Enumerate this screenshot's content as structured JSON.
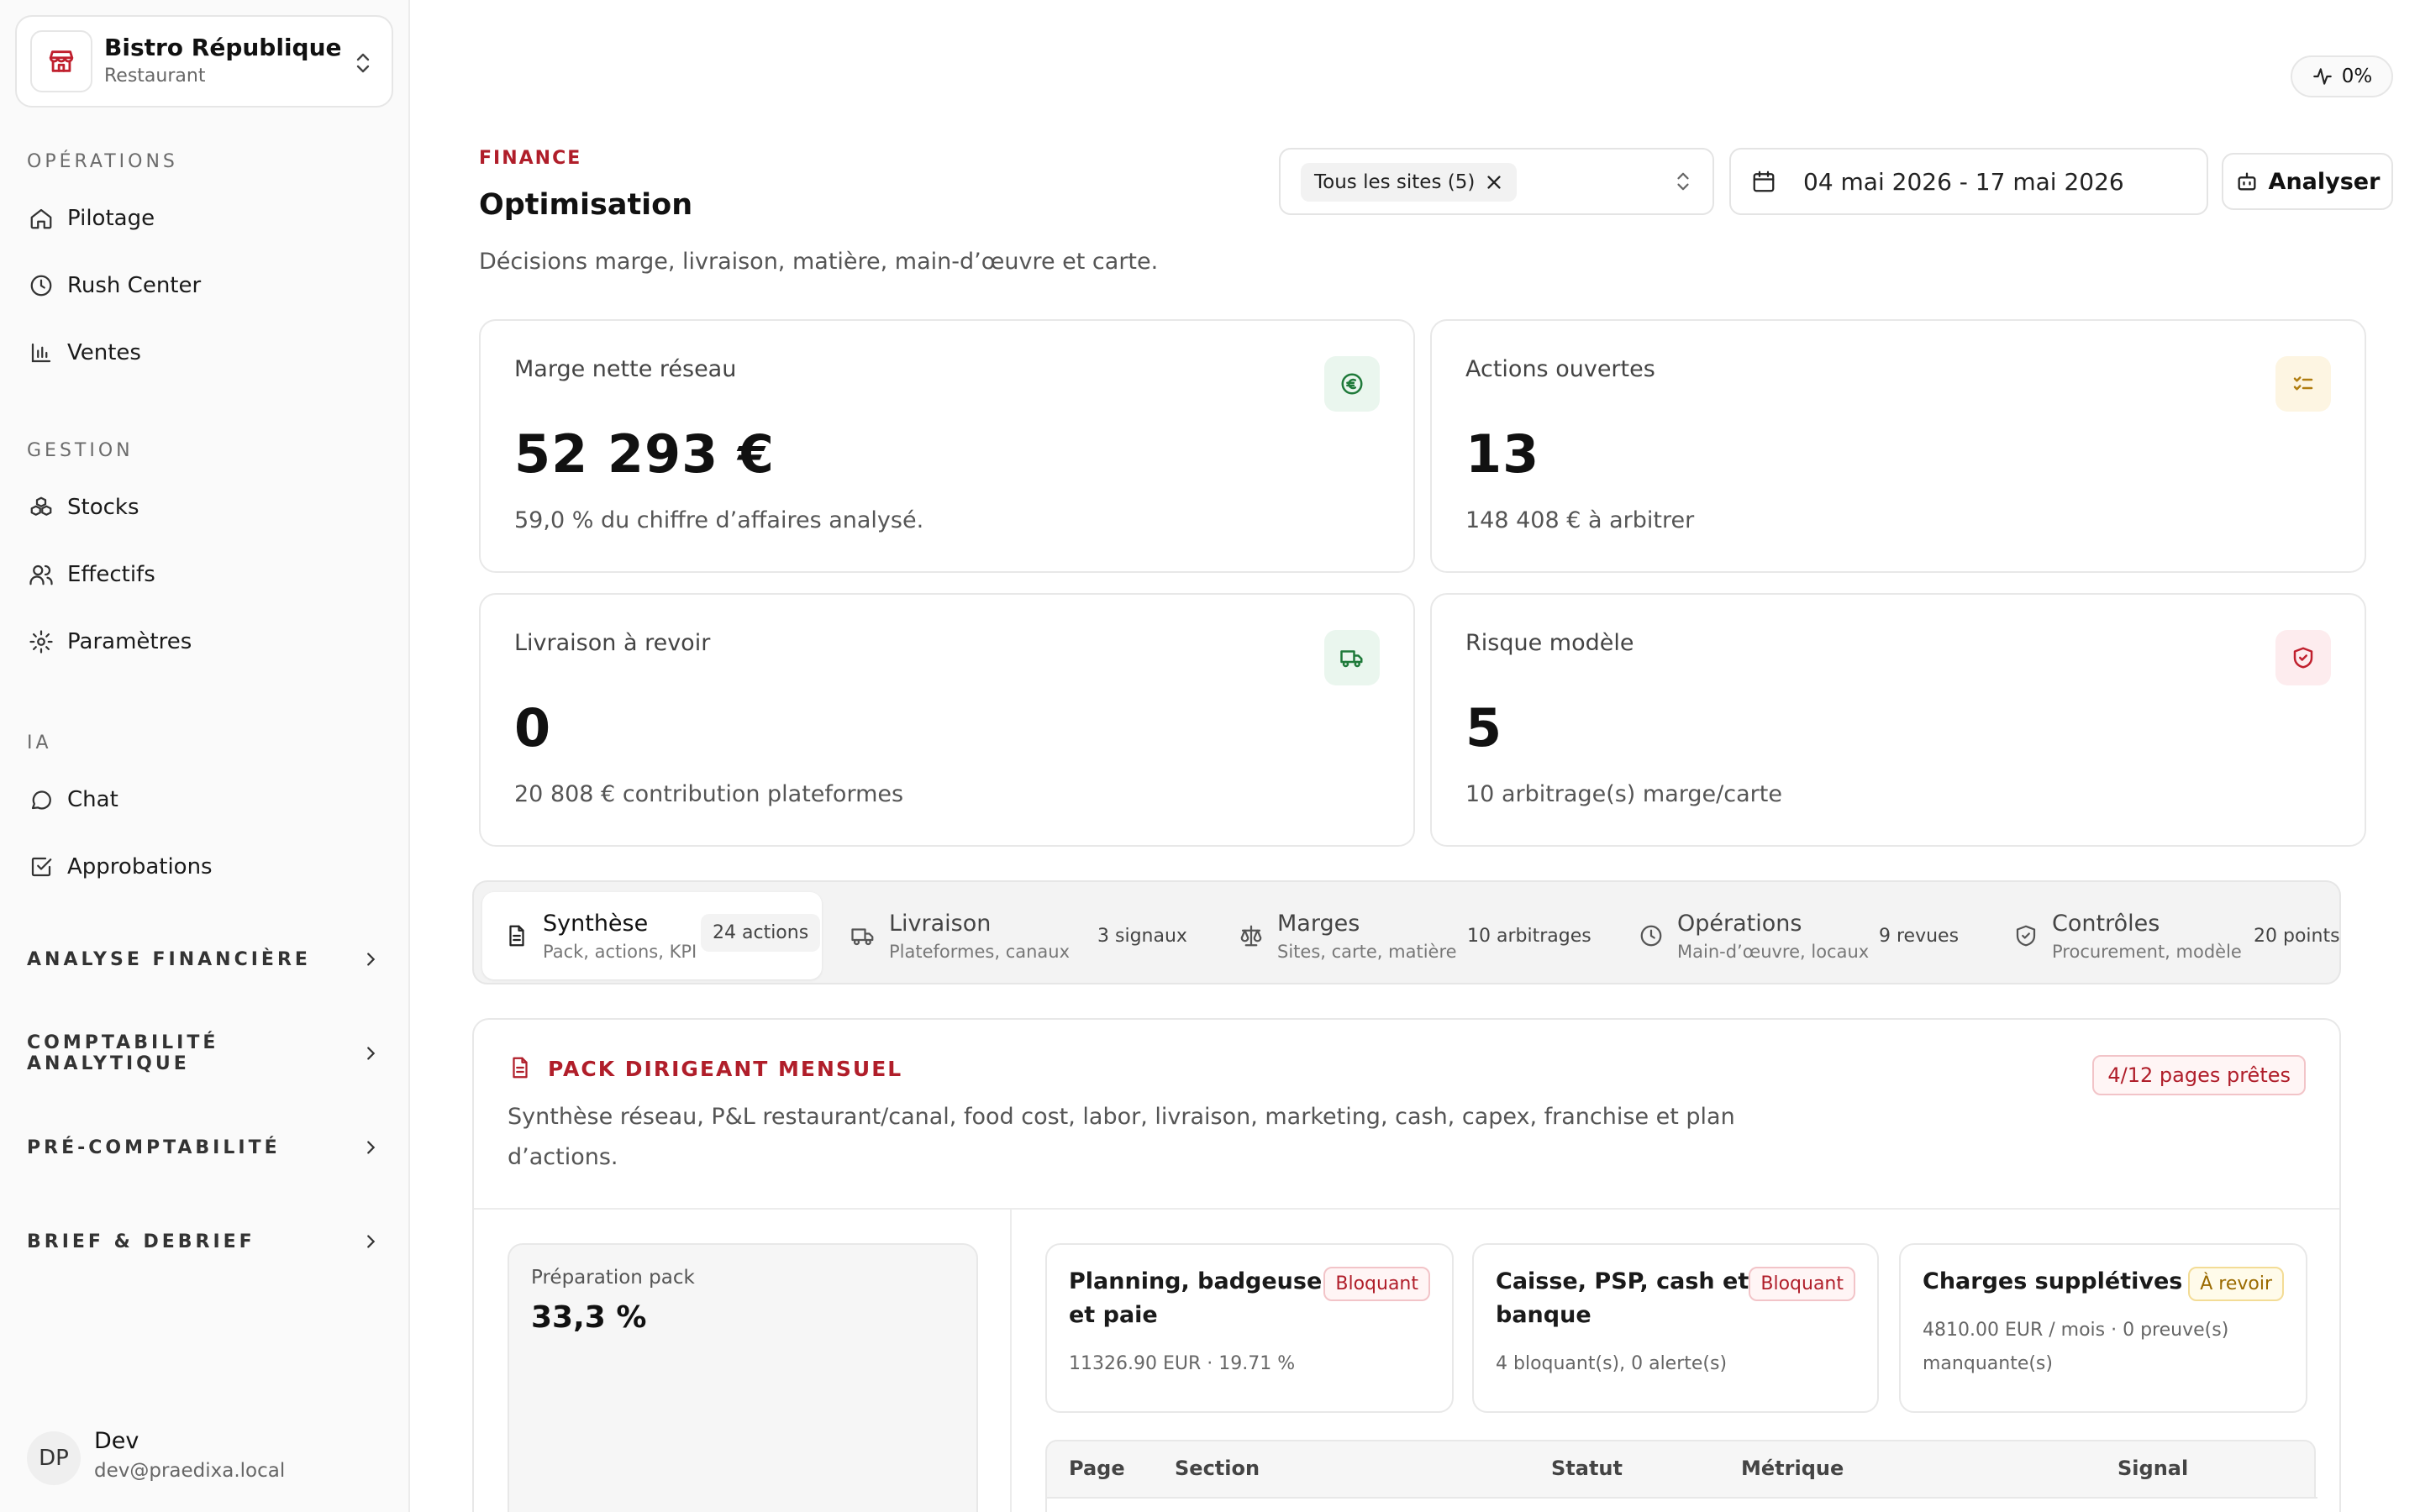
{
  "workspace": {
    "name": "Bistro République",
    "type": "Restaurant"
  },
  "sidebar": {
    "sections": [
      {
        "title": "OPÉRATIONS",
        "items": [
          {
            "label": "Pilotage",
            "icon": "home-icon"
          },
          {
            "label": "Rush Center",
            "icon": "clock-icon"
          },
          {
            "label": "Ventes",
            "icon": "bar-chart-icon"
          }
        ]
      },
      {
        "title": "GESTION",
        "items": [
          {
            "label": "Stocks",
            "icon": "boxes-icon"
          },
          {
            "label": "Effectifs",
            "icon": "users-icon"
          },
          {
            "label": "Paramètres",
            "icon": "gear-icon"
          }
        ]
      },
      {
        "title": "IA",
        "items": [
          {
            "label": "Chat",
            "icon": "chat-icon"
          },
          {
            "label": "Approbations",
            "icon": "checkbox-icon"
          }
        ]
      }
    ],
    "groups": [
      "ANALYSE FINANCIÈRE",
      "COMPTABILITÉ ANALYTIQUE",
      "PRÉ-COMPTABILITÉ",
      "BRIEF & DEBRIEF"
    ],
    "user": {
      "initials": "DP",
      "name": "Dev",
      "email": "dev@praedixa.local"
    }
  },
  "topbar": {
    "activity": "0%"
  },
  "header": {
    "eyebrow": "FINANCE",
    "title": "Optimisation",
    "subtitle": "Décisions marge, livraison, matière, main-d’œuvre et carte.",
    "site_filter": "Tous les sites (5)",
    "date_range": "04 mai 2026 - 17 mai 2026",
    "analyze": "Analyser"
  },
  "kpis": [
    {
      "label": "Marge nette réseau",
      "value": "52 293 €",
      "sub": "59,0 % du chiffre d’affaires analysé.",
      "icon": "euro-icon",
      "color": "#1f7a3a"
    },
    {
      "label": "Actions ouvertes",
      "value": "13",
      "sub": "148 408 € à arbitrer",
      "icon": "checklist-icon",
      "color": "#b07d10"
    },
    {
      "label": "Livraison à revoir",
      "value": "0",
      "sub": "20 808 € contribution plateformes",
      "icon": "truck-icon",
      "color": "#1f7a3a"
    },
    {
      "label": "Risque modèle",
      "value": "5",
      "sub": "10 arbitrage(s) marge/carte",
      "icon": "shield-icon",
      "color": "#c0202e"
    }
  ],
  "tabs": [
    {
      "label": "Synthèse",
      "sub": "Pack, actions, KPI",
      "count": "24 actions"
    },
    {
      "label": "Livraison",
      "sub": "Plateformes, canaux",
      "count": "3 signaux"
    },
    {
      "label": "Marges",
      "sub": "Sites, carte, matière",
      "count": "10 arbitrages"
    },
    {
      "label": "Opérations",
      "sub": "Main-d’œuvre, locaux",
      "count": "9 revues"
    },
    {
      "label": "Contrôles",
      "sub": "Procurement, modèle",
      "count": "20 points"
    }
  ],
  "pack": {
    "title": "PACK DIRIGEANT MENSUEL",
    "desc_line1": "Synthèse réseau, P&L restaurant/canal, food cost, labor, livraison, marketing, cash, capex, franchise et plan",
    "desc_line2": "d’actions.",
    "badge": "4/12 pages prêtes",
    "prep_label": "Préparation pack",
    "prep_value": "33,3 %",
    "prep_progress": 0.333,
    "cards": [
      {
        "title1": "Planning, badgeuse",
        "title2": "et paie",
        "badge": "Bloquant",
        "meta1": "11326.90 EUR · 19.71 %",
        "meta2": ""
      },
      {
        "title1": "Caisse, PSP, cash et",
        "title2": "banque",
        "badge": "Bloquant",
        "meta1": "4 bloquant(s), 0 alerte(s)",
        "meta2": ""
      },
      {
        "title1": "Charges supplétives",
        "title2": "",
        "badge": "À revoir",
        "meta1": "4810.00 EUR / mois · 0 preuve(s)",
        "meta2": "manquante(s)"
      }
    ],
    "table_headers": [
      "Page",
      "Section",
      "Statut",
      "Métrique",
      "Signal"
    ]
  },
  "colors": {
    "accent": "#b01e2a",
    "border": "#e8e8e8",
    "muted": "#f6f6f6"
  }
}
